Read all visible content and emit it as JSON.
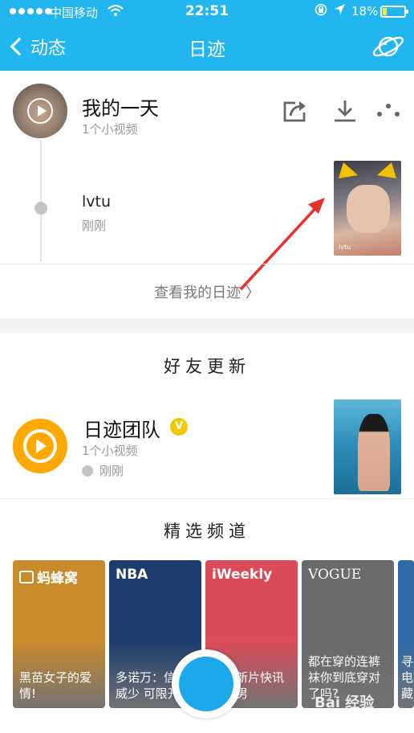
{
  "status_bar": {
    "carrier": "中国移动",
    "time": "22:51",
    "battery": "18%",
    "battery_level": 0.18
  },
  "nav": {
    "back_label": "动态",
    "title": "日迹",
    "planet_icon": "planet-icon"
  },
  "my_day": {
    "title": "我的一天",
    "subtitle": "1个小视频",
    "actions": [
      "share-icon",
      "download-icon",
      "more-icon"
    ],
    "entry_name": "lvtu",
    "entry_time": "刚刚",
    "thumb_label": "lvtu",
    "view_link": "查看我的日迹 〉"
  },
  "friends": {
    "section_title": "好友更新",
    "name": "日迹团队",
    "badge": "V",
    "subtitle": "1个小视频",
    "time": "刚刚"
  },
  "channels": {
    "section_title": "精选频道",
    "items": [
      {
        "brand": "蚂蜂窝",
        "text": "黑苗女子的爱情!",
        "color": "#c98a2a"
      },
      {
        "brand": "NBA",
        "text": "多诺万：信任威少 可限开火",
        "color": "#1d3d6e"
      },
      {
        "brand": "iWeekly",
        "text": "星战新片快讯 快盗男",
        "color": "#d94b59"
      },
      {
        "brand": "VOGUE",
        "text": "都在穿的连裤袜你到底穿对了吗?",
        "color": "#6a6a6a"
      },
      {
        "brand": "",
        "text": "寻电藏",
        "color": "#2f6ba8"
      }
    ]
  },
  "colors": {
    "accent": "#21b6f0",
    "record": "#1ca9ec",
    "team_logo": "#ffa800",
    "arrow": "#e8312f"
  },
  "watermark": "Bai 经验"
}
